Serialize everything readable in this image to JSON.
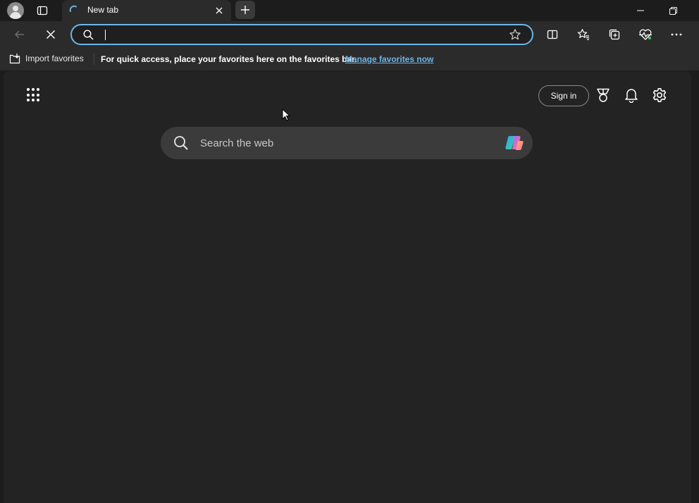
{
  "window": {
    "tab_title": "New tab"
  },
  "address_bar": {
    "value": "",
    "placeholder": ""
  },
  "favorites_bar": {
    "import_label": "Import favorites",
    "message": "For quick access, place your favorites here on the favorites bar.",
    "link_label": "Manage favorites now"
  },
  "newtab_page": {
    "sign_in_label": "Sign in",
    "search_placeholder": "Search the web"
  },
  "icons": {
    "titlebar": [
      "profile-avatar",
      "tab-actions-icon",
      "loading-spinner-icon",
      "close-tab-icon",
      "new-tab-icon",
      "minimize-icon",
      "restore-icon"
    ],
    "toolbar": [
      "back-icon",
      "stop-icon",
      "search-icon",
      "favorite-star-icon",
      "split-screen-icon",
      "favorites-icon",
      "collections-icon",
      "browser-essentials-icon",
      "more-icon"
    ],
    "page": [
      "apps-launcher-icon",
      "rewards-icon",
      "notifications-icon",
      "settings-icon",
      "copilot-icon"
    ]
  },
  "colors": {
    "accent": "#6db6e8",
    "background": "#1c1c1c",
    "page_background": "#232323",
    "search_box": "#3b3b3b"
  }
}
